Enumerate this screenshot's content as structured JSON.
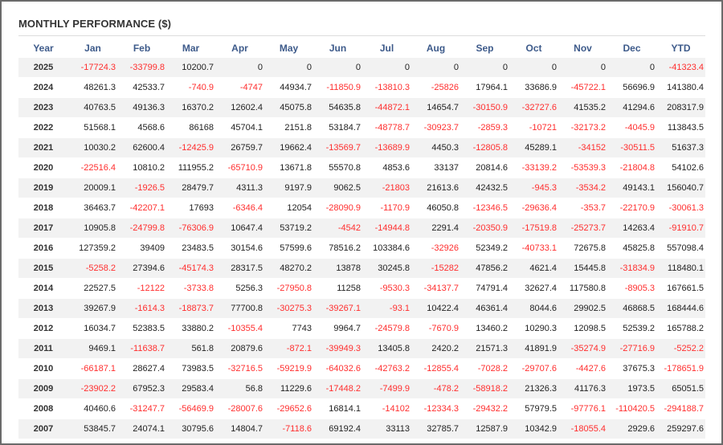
{
  "panel": {
    "title": "MONTHLY PERFORMANCE ($)"
  },
  "colors": {
    "header_text": "#3d5a8a",
    "negative_value": "#ff2e2e",
    "positive_value": "#222222",
    "row_stripe": "#f2f2f2"
  },
  "chart_data": {
    "type": "table",
    "title": "MONTHLY PERFORMANCE ($)",
    "columns": [
      "Year",
      "Jan",
      "Feb",
      "Mar",
      "Apr",
      "May",
      "Jun",
      "Jul",
      "Aug",
      "Sep",
      "Oct",
      "Nov",
      "Dec",
      "YTD"
    ],
    "rows": [
      [
        "2025",
        "-17724.3",
        "-33799.8",
        "10200.7",
        "0",
        "0",
        "0",
        "0",
        "0",
        "0",
        "0",
        "0",
        "0",
        "-41323.4"
      ],
      [
        "2024",
        "48261.3",
        "42533.7",
        "-740.9",
        "-4747",
        "44934.7",
        "-11850.9",
        "-13810.3",
        "-25826",
        "17964.1",
        "33686.9",
        "-45722.1",
        "56696.9",
        "141380.4"
      ],
      [
        "2023",
        "40763.5",
        "49136.3",
        "16370.2",
        "12602.4",
        "45075.8",
        "54635.8",
        "-44872.1",
        "14654.7",
        "-30150.9",
        "-32727.6",
        "41535.2",
        "41294.6",
        "208317.9"
      ],
      [
        "2022",
        "51568.1",
        "4568.6",
        "86168",
        "45704.1",
        "2151.8",
        "53184.7",
        "-48778.7",
        "-30923.7",
        "-2859.3",
        "-10721",
        "-32173.2",
        "-4045.9",
        "113843.5"
      ],
      [
        "2021",
        "10030.2",
        "62600.4",
        "-12425.9",
        "26759.7",
        "19662.4",
        "-13569.7",
        "-13689.9",
        "4450.3",
        "-12805.8",
        "45289.1",
        "-34152",
        "-30511.5",
        "51637.3"
      ],
      [
        "2020",
        "-22516.4",
        "10810.2",
        "111955.2",
        "-65710.9",
        "13671.8",
        "55570.8",
        "4853.6",
        "33137",
        "20814.6",
        "-33139.2",
        "-53539.3",
        "-21804.8",
        "54102.6"
      ],
      [
        "2019",
        "20009.1",
        "-1926.5",
        "28479.7",
        "4311.3",
        "9197.9",
        "9062.5",
        "-21803",
        "21613.6",
        "42432.5",
        "-945.3",
        "-3534.2",
        "49143.1",
        "156040.7"
      ],
      [
        "2018",
        "36463.7",
        "-42207.1",
        "17693",
        "-6346.4",
        "12054",
        "-28090.9",
        "-1170.9",
        "46050.8",
        "-12346.5",
        "-29636.4",
        "-353.7",
        "-22170.9",
        "-30061.3"
      ],
      [
        "2017",
        "10905.8",
        "-24799.8",
        "-76306.9",
        "10647.4",
        "53719.2",
        "-4542",
        "-14944.8",
        "2291.4",
        "-20350.9",
        "-17519.8",
        "-25273.7",
        "14263.4",
        "-91910.7"
      ],
      [
        "2016",
        "127359.2",
        "39409",
        "23483.5",
        "30154.6",
        "57599.6",
        "78516.2",
        "103384.6",
        "-32926",
        "52349.2",
        "-40733.1",
        "72675.8",
        "45825.8",
        "557098.4"
      ],
      [
        "2015",
        "-5258.2",
        "27394.6",
        "-45174.3",
        "28317.5",
        "48270.2",
        "13878",
        "30245.8",
        "-15282",
        "47856.2",
        "4621.4",
        "15445.8",
        "-31834.9",
        "118480.1"
      ],
      [
        "2014",
        "22527.5",
        "-12122",
        "-3733.8",
        "5256.3",
        "-27950.8",
        "11258",
        "-9530.3",
        "-34137.7",
        "74791.4",
        "32627.4",
        "117580.8",
        "-8905.3",
        "167661.5"
      ],
      [
        "2013",
        "39267.9",
        "-1614.3",
        "-18873.7",
        "77700.8",
        "-30275.3",
        "-39267.1",
        "-93.1",
        "10422.4",
        "46361.4",
        "8044.6",
        "29902.5",
        "46868.5",
        "168444.6"
      ],
      [
        "2012",
        "16034.7",
        "52383.5",
        "33880.2",
        "-10355.4",
        "7743",
        "9964.7",
        "-24579.8",
        "-7670.9",
        "13460.2",
        "10290.3",
        "12098.5",
        "52539.2",
        "165788.2"
      ],
      [
        "2011",
        "9469.1",
        "-11638.7",
        "561.8",
        "20879.6",
        "-872.1",
        "-39949.3",
        "13405.8",
        "2420.2",
        "21571.3",
        "41891.9",
        "-35274.9",
        "-27716.9",
        "-5252.2"
      ],
      [
        "2010",
        "-66187.1",
        "28627.4",
        "73983.5",
        "-32716.5",
        "-59219.9",
        "-64032.6",
        "-42763.2",
        "-12855.4",
        "-7028.2",
        "-29707.6",
        "-4427.6",
        "37675.3",
        "-178651.9"
      ],
      [
        "2009",
        "-23902.2",
        "67952.3",
        "29583.4",
        "56.8",
        "11229.6",
        "-17448.2",
        "-7499.9",
        "-478.2",
        "-58918.2",
        "21326.3",
        "41176.3",
        "1973.5",
        "65051.5"
      ],
      [
        "2008",
        "40460.6",
        "-31247.7",
        "-56469.9",
        "-28007.6",
        "-29652.6",
        "16814.1",
        "-14102",
        "-12334.3",
        "-29432.2",
        "57979.5",
        "-97776.1",
        "-110420.5",
        "-294188.7"
      ],
      [
        "2007",
        "53845.7",
        "24074.1",
        "30795.6",
        "14804.7",
        "-7118.6",
        "69192.4",
        "33113",
        "32785.7",
        "12587.9",
        "10342.9",
        "-18055.4",
        "2929.6",
        "259297.6"
      ]
    ]
  }
}
